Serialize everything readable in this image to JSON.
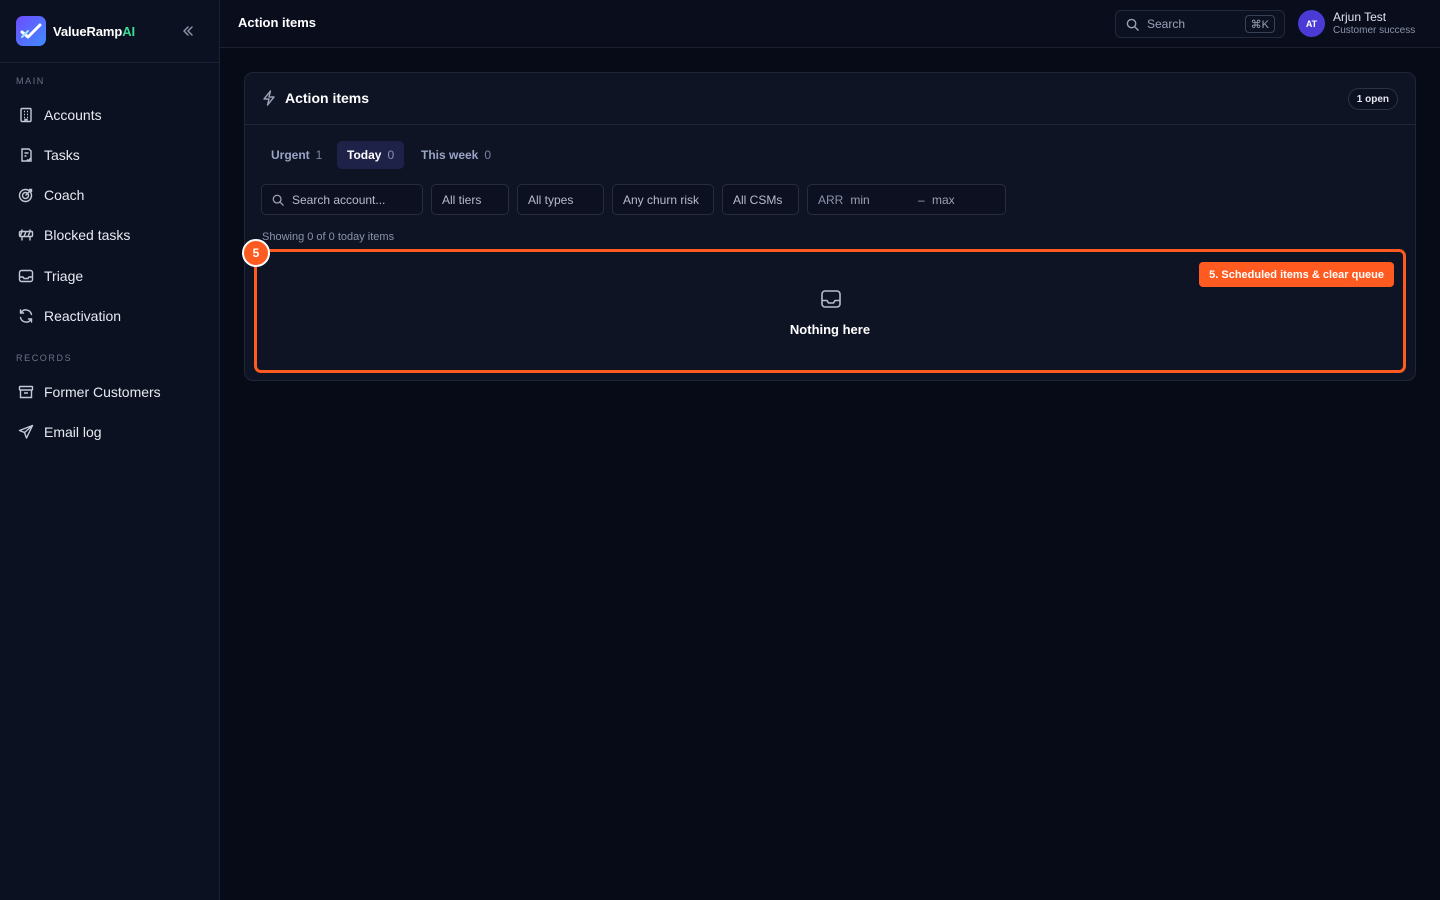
{
  "brand": {
    "name_main": "ValueRamp",
    "name_accent": "AI"
  },
  "sidebar": {
    "section_main": "MAIN",
    "section_records": "RECORDS",
    "main_items": [
      {
        "label": "Accounts",
        "icon": "building-icon"
      },
      {
        "label": "Tasks",
        "icon": "clipboard-icon"
      },
      {
        "label": "Coach",
        "icon": "target-icon"
      },
      {
        "label": "Blocked tasks",
        "icon": "roadblock-icon"
      },
      {
        "label": "Triage",
        "icon": "inbox-icon"
      },
      {
        "label": "Reactivation",
        "icon": "refresh-icon"
      }
    ],
    "record_items": [
      {
        "label": "Former Customers",
        "icon": "archive-icon"
      },
      {
        "label": "Email log",
        "icon": "send-icon"
      }
    ]
  },
  "topbar": {
    "title": "Action items",
    "search_label": "Search",
    "shortcut": "⌘K",
    "user": {
      "initials": "AT",
      "name": "Arjun Test",
      "role": "Customer success"
    }
  },
  "card": {
    "title": "Action items",
    "open_badge": "1 open",
    "tabs": [
      {
        "label": "Urgent",
        "count": "1"
      },
      {
        "label": "Today",
        "count": "0"
      },
      {
        "label": "This week",
        "count": "0"
      }
    ],
    "filters": {
      "search_placeholder": "Search account...",
      "tiers": "All tiers",
      "types": "All types",
      "churn": "Any churn risk",
      "csms": "All CSMs",
      "arr_label": "ARR",
      "arr_min": "min",
      "arr_dash": "–",
      "arr_max": "max"
    },
    "showing": "Showing 0 of 0 today items",
    "empty": "Nothing here"
  },
  "annotation": {
    "step": "5",
    "label": "5. Scheduled items & clear queue"
  },
  "colors": {
    "accent": "#ff5a1f",
    "brand_green": "#3ddc97",
    "active_tab": "#1e2148"
  }
}
